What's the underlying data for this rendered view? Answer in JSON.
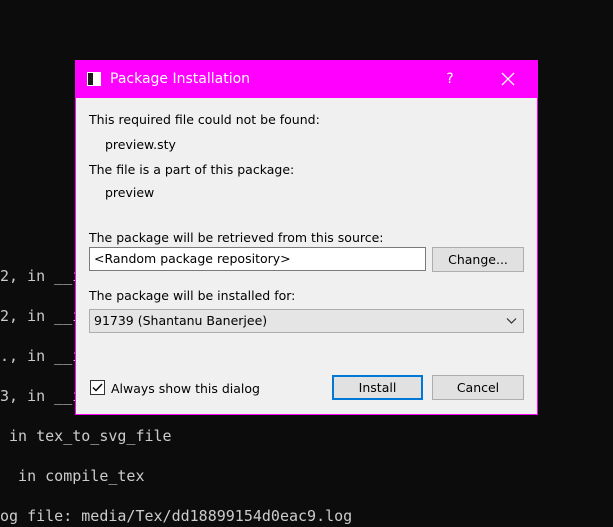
{
  "terminal": {
    "lines": [
      "2, in __i",
      "2, in __i",
      "., in __i",
      "3, in __i",
      " in tex_to_svg_file",
      "  in compile_tex",
      "og file: media/Tex/dd18899154d0eac9.log"
    ]
  },
  "dialog": {
    "title": "Package Installation",
    "help_glyph": "?",
    "not_found_label": "This required file could not be found:",
    "file_name": "preview.sty",
    "package_label": "The file is a part of this package:",
    "package_name": "preview",
    "source_label": "The package will be retrieved from this source:",
    "source_value": "<Random package repository>",
    "change_button": "Change...",
    "install_for_label": "The package will be installed for:",
    "install_for_value": "91739 (Shantanu Banerjee)",
    "always_show_label": "Always show this dialog",
    "always_show_checked": true,
    "install_button": "Install",
    "cancel_button": "Cancel"
  },
  "colors": {
    "titlebar": "#ff00ff",
    "dialog_bg": "#f0f0f0",
    "default_button_border": "#0078d7",
    "terminal_bg": "#0c0c0c"
  },
  "icons": {
    "app": "window-app-icon",
    "close": "close-icon",
    "dropdown": "chevron-down-icon",
    "check": "check-icon"
  }
}
